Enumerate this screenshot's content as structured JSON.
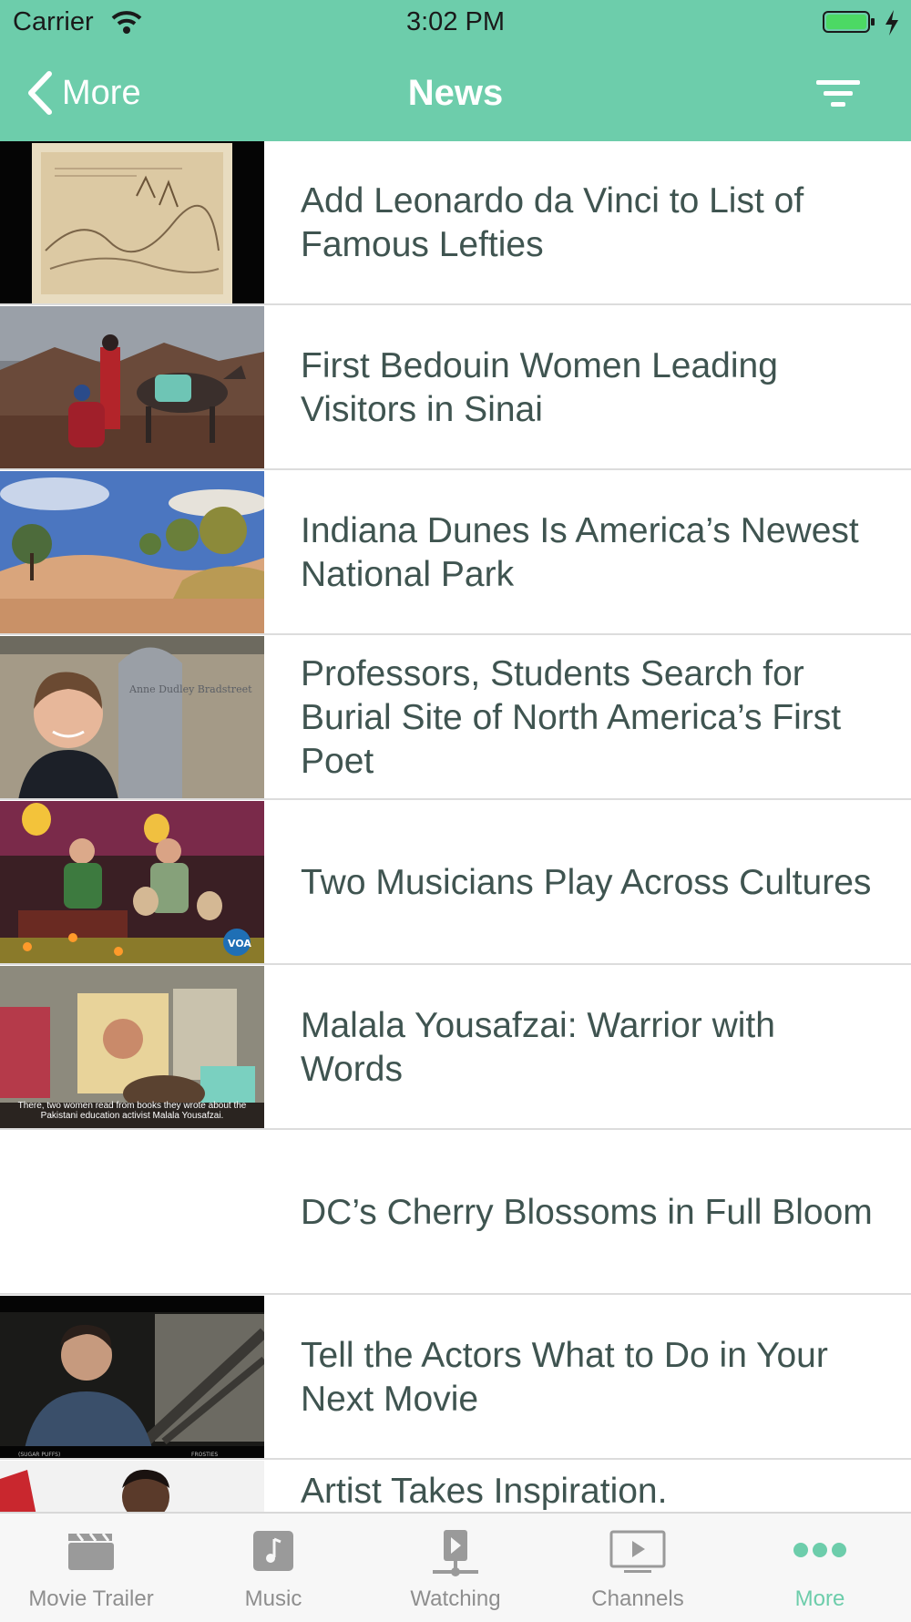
{
  "status_bar": {
    "carrier": "Carrier",
    "time": "3:02 PM"
  },
  "nav": {
    "back_label": "More",
    "title": "News"
  },
  "colors": {
    "accent": "#6dcdab",
    "title_text": "#3f5450",
    "tab_inactive": "#8e8e8e"
  },
  "articles": [
    {
      "title": "Add Leonardo da Vinci to List of Famous Lefties"
    },
    {
      "title": "First Bedouin Women Leading Visitors in Sinai"
    },
    {
      "title": "Indiana Dunes Is America’s Newest National Park"
    },
    {
      "title": "Professors, Students Search for Burial Site of North America’s First Poet"
    },
    {
      "title": "Two Musicians Play Across Cultures"
    },
    {
      "title": "Malala Yousafzai: Warrior with Words"
    },
    {
      "title": "DC’s Cherry Blossoms in Full Bloom"
    },
    {
      "title": "Tell the Actors What to Do in Your Next Movie"
    },
    {
      "title": "Artist Takes Inspiration."
    }
  ],
  "thumb_texts": {
    "headstone": "Anne Dudley Bradstreet",
    "voa_badge": "VOA",
    "malala_caption": "There, two women read from books they wrote about the Pakistani education activist Malala Yousafzai.",
    "movie_left": "(SUGAR PUFFS)",
    "movie_right": "FROSTIES"
  },
  "tabs": [
    {
      "label": "Movie Trailer",
      "icon": "clapperboard-icon"
    },
    {
      "label": "Music",
      "icon": "music-note-icon"
    },
    {
      "label": "Watching",
      "icon": "video-network-icon"
    },
    {
      "label": "Channels",
      "icon": "tv-icon"
    },
    {
      "label": "More",
      "icon": "more-dots-icon",
      "active": true
    }
  ]
}
